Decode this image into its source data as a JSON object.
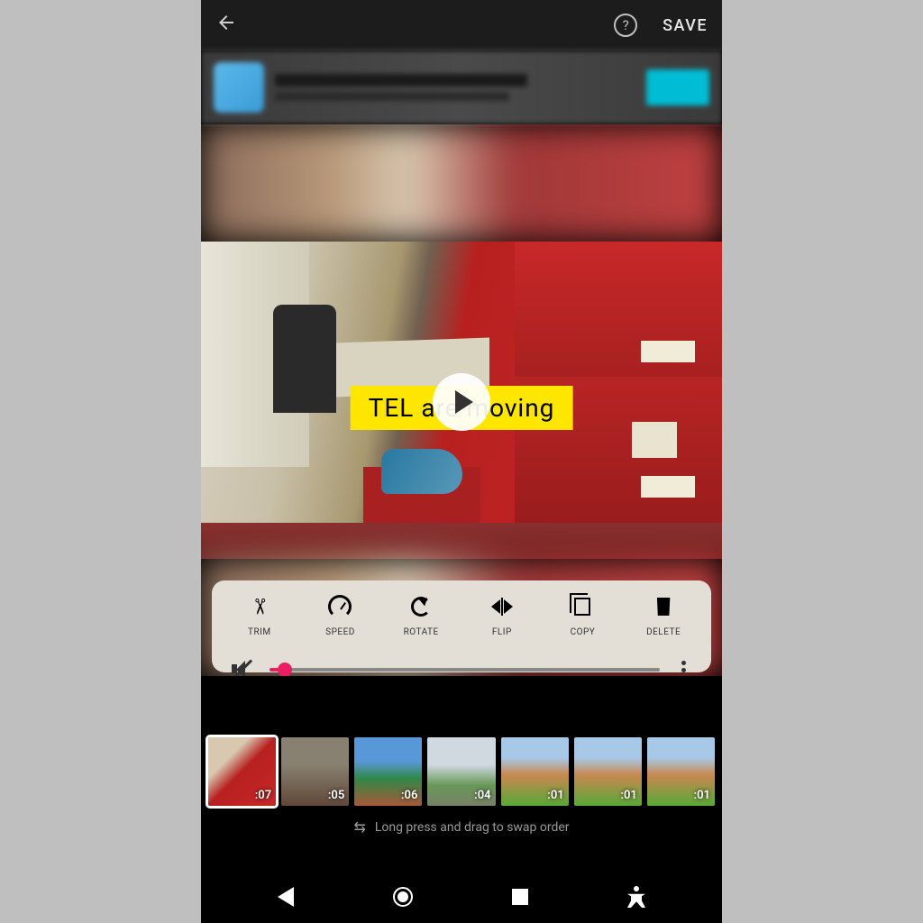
{
  "topbar": {
    "save_label": "SAVE"
  },
  "preview": {
    "caption": "TEL are moving"
  },
  "tools": {
    "trim": "TRIM",
    "speed": "SPEED",
    "rotate": "ROTATE",
    "flip": "FLIP",
    "copy": "COPY",
    "delete": "DELETE"
  },
  "clips": [
    {
      "duration": ":07",
      "selected": true
    },
    {
      "duration": ":05",
      "selected": false
    },
    {
      "duration": ":06",
      "selected": false
    },
    {
      "duration": ":04",
      "selected": false
    },
    {
      "duration": ":01",
      "selected": false
    },
    {
      "duration": ":01",
      "selected": false
    },
    {
      "duration": ":01",
      "selected": false
    }
  ],
  "hint": "Long press and drag to swap order",
  "colors": {
    "accent": "#e91e63",
    "caption_bg": "#ffe600",
    "ad_cta": "#00bcd4"
  }
}
